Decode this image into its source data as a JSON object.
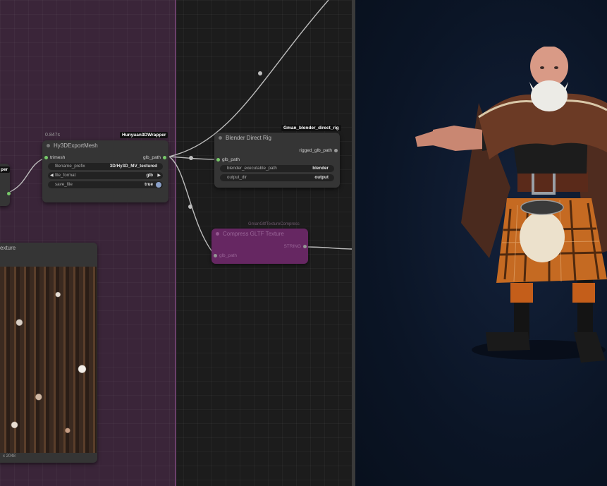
{
  "nodes": {
    "export_mesh": {
      "title": "Hy3DExportMesh",
      "time": "0.847s",
      "badge": "Hunyuan3DWrapper",
      "input": "trimesh",
      "output": "glb_path",
      "widgets": [
        {
          "label": "filename_prefix",
          "value": "3D/Hy3D_MV_textured"
        },
        {
          "label": "file_format",
          "value": "glb"
        },
        {
          "label": "save_file",
          "value": "true"
        }
      ]
    },
    "blender_rig": {
      "title": "Blender Direct Rig",
      "badge": "Gman_blender_direct_rig",
      "input": "glb_path",
      "output": "rigged_glb_path",
      "widgets": [
        {
          "label": "blender_executable_path",
          "value": "blender"
        },
        {
          "label": "output_dir",
          "value": "output"
        }
      ]
    },
    "compress": {
      "title": "Compress GLTF Texture",
      "badge": "GmanGltfTextureCompress",
      "input": "glb_path",
      "output": "STRING"
    },
    "partial_left": {
      "title_fragment": "per"
    },
    "texture_preview": {
      "title_fragment": "exture",
      "footer": "x 2048"
    }
  },
  "colors": {
    "group_bg": "#3a2539",
    "canvas_bg": "#1c1c1c",
    "viewer_bg": "#0b1526",
    "link": "#bdbdbd",
    "socket_active": "#78c96a",
    "bypass_node": "#6a2866"
  }
}
